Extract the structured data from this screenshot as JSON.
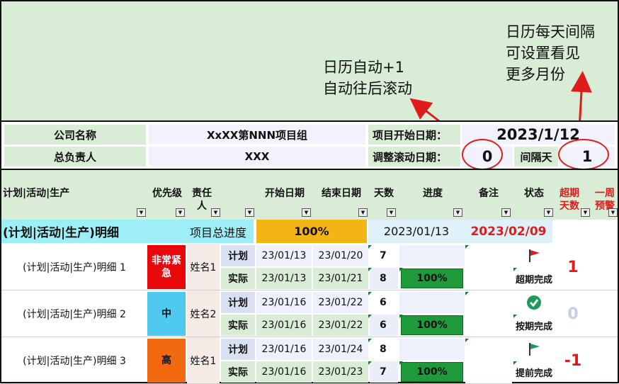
{
  "notes": {
    "left": "日历自动+1\n自动往后滚动",
    "right": "日历每天间隔\n可设置看见\n更多月份"
  },
  "info": {
    "company_label": "公司名称",
    "company_value": "XxXX第NNN项目组",
    "owner_label": "总负责人",
    "owner_value": "XXX",
    "start_label": "项目开始日期：",
    "start_value": "2023/1/12",
    "scroll_label": "调整滚动日期：",
    "scroll_value": "0",
    "interval_label": "间隔天",
    "interval_value": "1"
  },
  "headers": {
    "activity": "计划|活动|生产",
    "priority": "优先级",
    "owner": "责任人",
    "start": "开始日期",
    "end": "结束日期",
    "days": "天数",
    "progress": "进度",
    "remark": "备注",
    "status": "状态",
    "overdue": "超期天数",
    "week": "一周预警"
  },
  "summary": {
    "title": "(计划|活动|生产)明细",
    "progress_label": "项目总进度",
    "progress_value": "100%",
    "date": "2023/01/13",
    "date_red": "2023/02/09"
  },
  "rows": [
    {
      "name": "(计划|活动|生产)明细 1",
      "priority": "非常紧急",
      "priority_color": "#e8080c",
      "owner": "姓名1",
      "plan_label": "计划",
      "plan_start": "23/01/13",
      "plan_end": "23/01/20",
      "plan_days": "7",
      "act_label": "实际",
      "act_start": "23/01/13",
      "act_end": "23/01/21",
      "act_days": "8",
      "progress": "100%",
      "status_icon": "red-flag-icon",
      "status": "超期完成",
      "overdue": "1",
      "overdue_color": "#e01b1b"
    },
    {
      "name": "(计划|活动|生产)明细 2",
      "priority": "中",
      "priority_color": "#4fc9f0",
      "owner": "姓名2",
      "plan_label": "计划",
      "plan_start": "23/01/16",
      "plan_end": "23/01/22",
      "plan_days": "6",
      "act_label": "实际",
      "act_start": "23/01/16",
      "act_end": "23/01/22",
      "act_days": "6",
      "progress": "100%",
      "status_icon": "green-check-icon",
      "status": "按期完成",
      "overdue": "0",
      "overdue_color": "#c5cde8"
    },
    {
      "name": "(计划|活动|生产)明细 3",
      "priority": "高",
      "priority_color": "#f26a10",
      "owner": "姓名1",
      "plan_label": "计划",
      "plan_start": "23/01/16",
      "plan_end": "23/01/24",
      "plan_days": "8",
      "act_label": "实际",
      "act_start": "23/01/16",
      "act_end": "23/01/23",
      "act_days": "7",
      "progress": "100%",
      "status_icon": "green-flag-icon",
      "status": "提前完成",
      "overdue": "-1",
      "overdue_color": "#e01b1b"
    }
  ]
}
